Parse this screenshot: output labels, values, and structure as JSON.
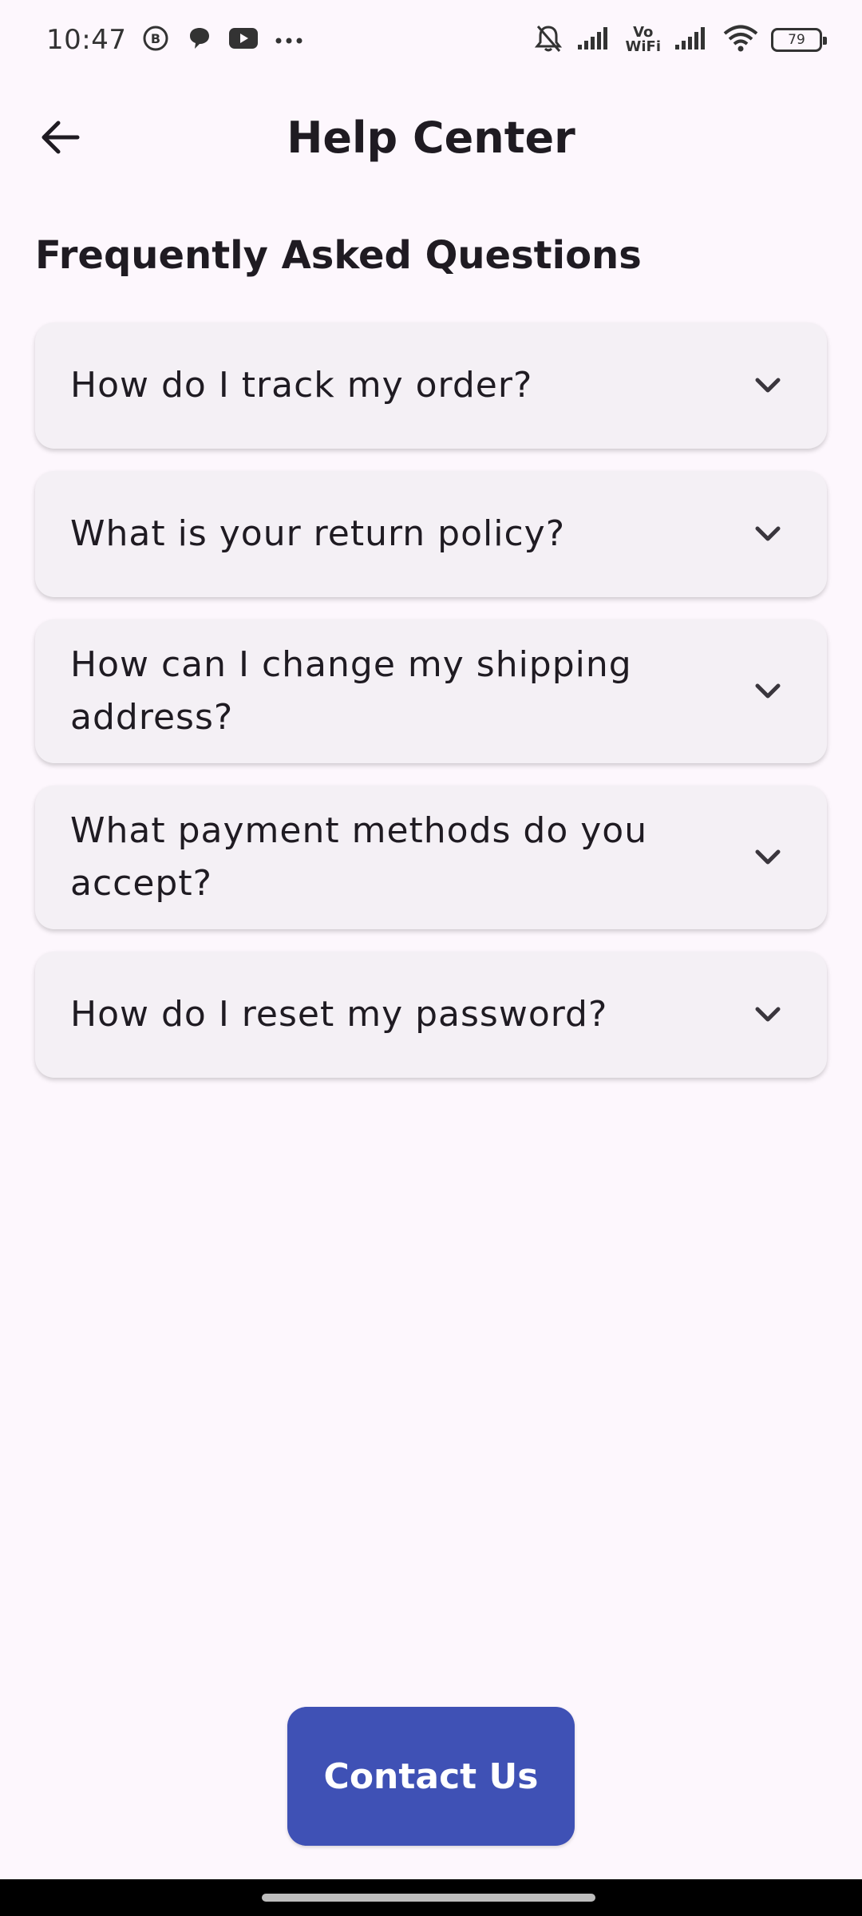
{
  "status_bar": {
    "time": "10:47",
    "icons_left": [
      "bbm-icon",
      "chat-bubble-icon",
      "youtube-icon",
      "more-dots-icon"
    ],
    "vowifi_top": "Vo",
    "vowifi_bottom": "WiFi",
    "battery_level": "79"
  },
  "header": {
    "title": "Help Center",
    "back_icon": "arrow-back-icon"
  },
  "faq": {
    "section_title": "Frequently Asked Questions",
    "items": [
      {
        "question": "How do I track my order?"
      },
      {
        "question": "What is your return policy?"
      },
      {
        "question": "How can I change my shipping address?"
      },
      {
        "question": "What payment methods do you accept?"
      },
      {
        "question": "How do I reset my password?"
      }
    ]
  },
  "contact_button": {
    "label": "Contact Us"
  },
  "colors": {
    "background": "#FDF7FD",
    "card": "#F4F0F5",
    "primary": "#3F51B5",
    "text": "#1F1B22"
  }
}
